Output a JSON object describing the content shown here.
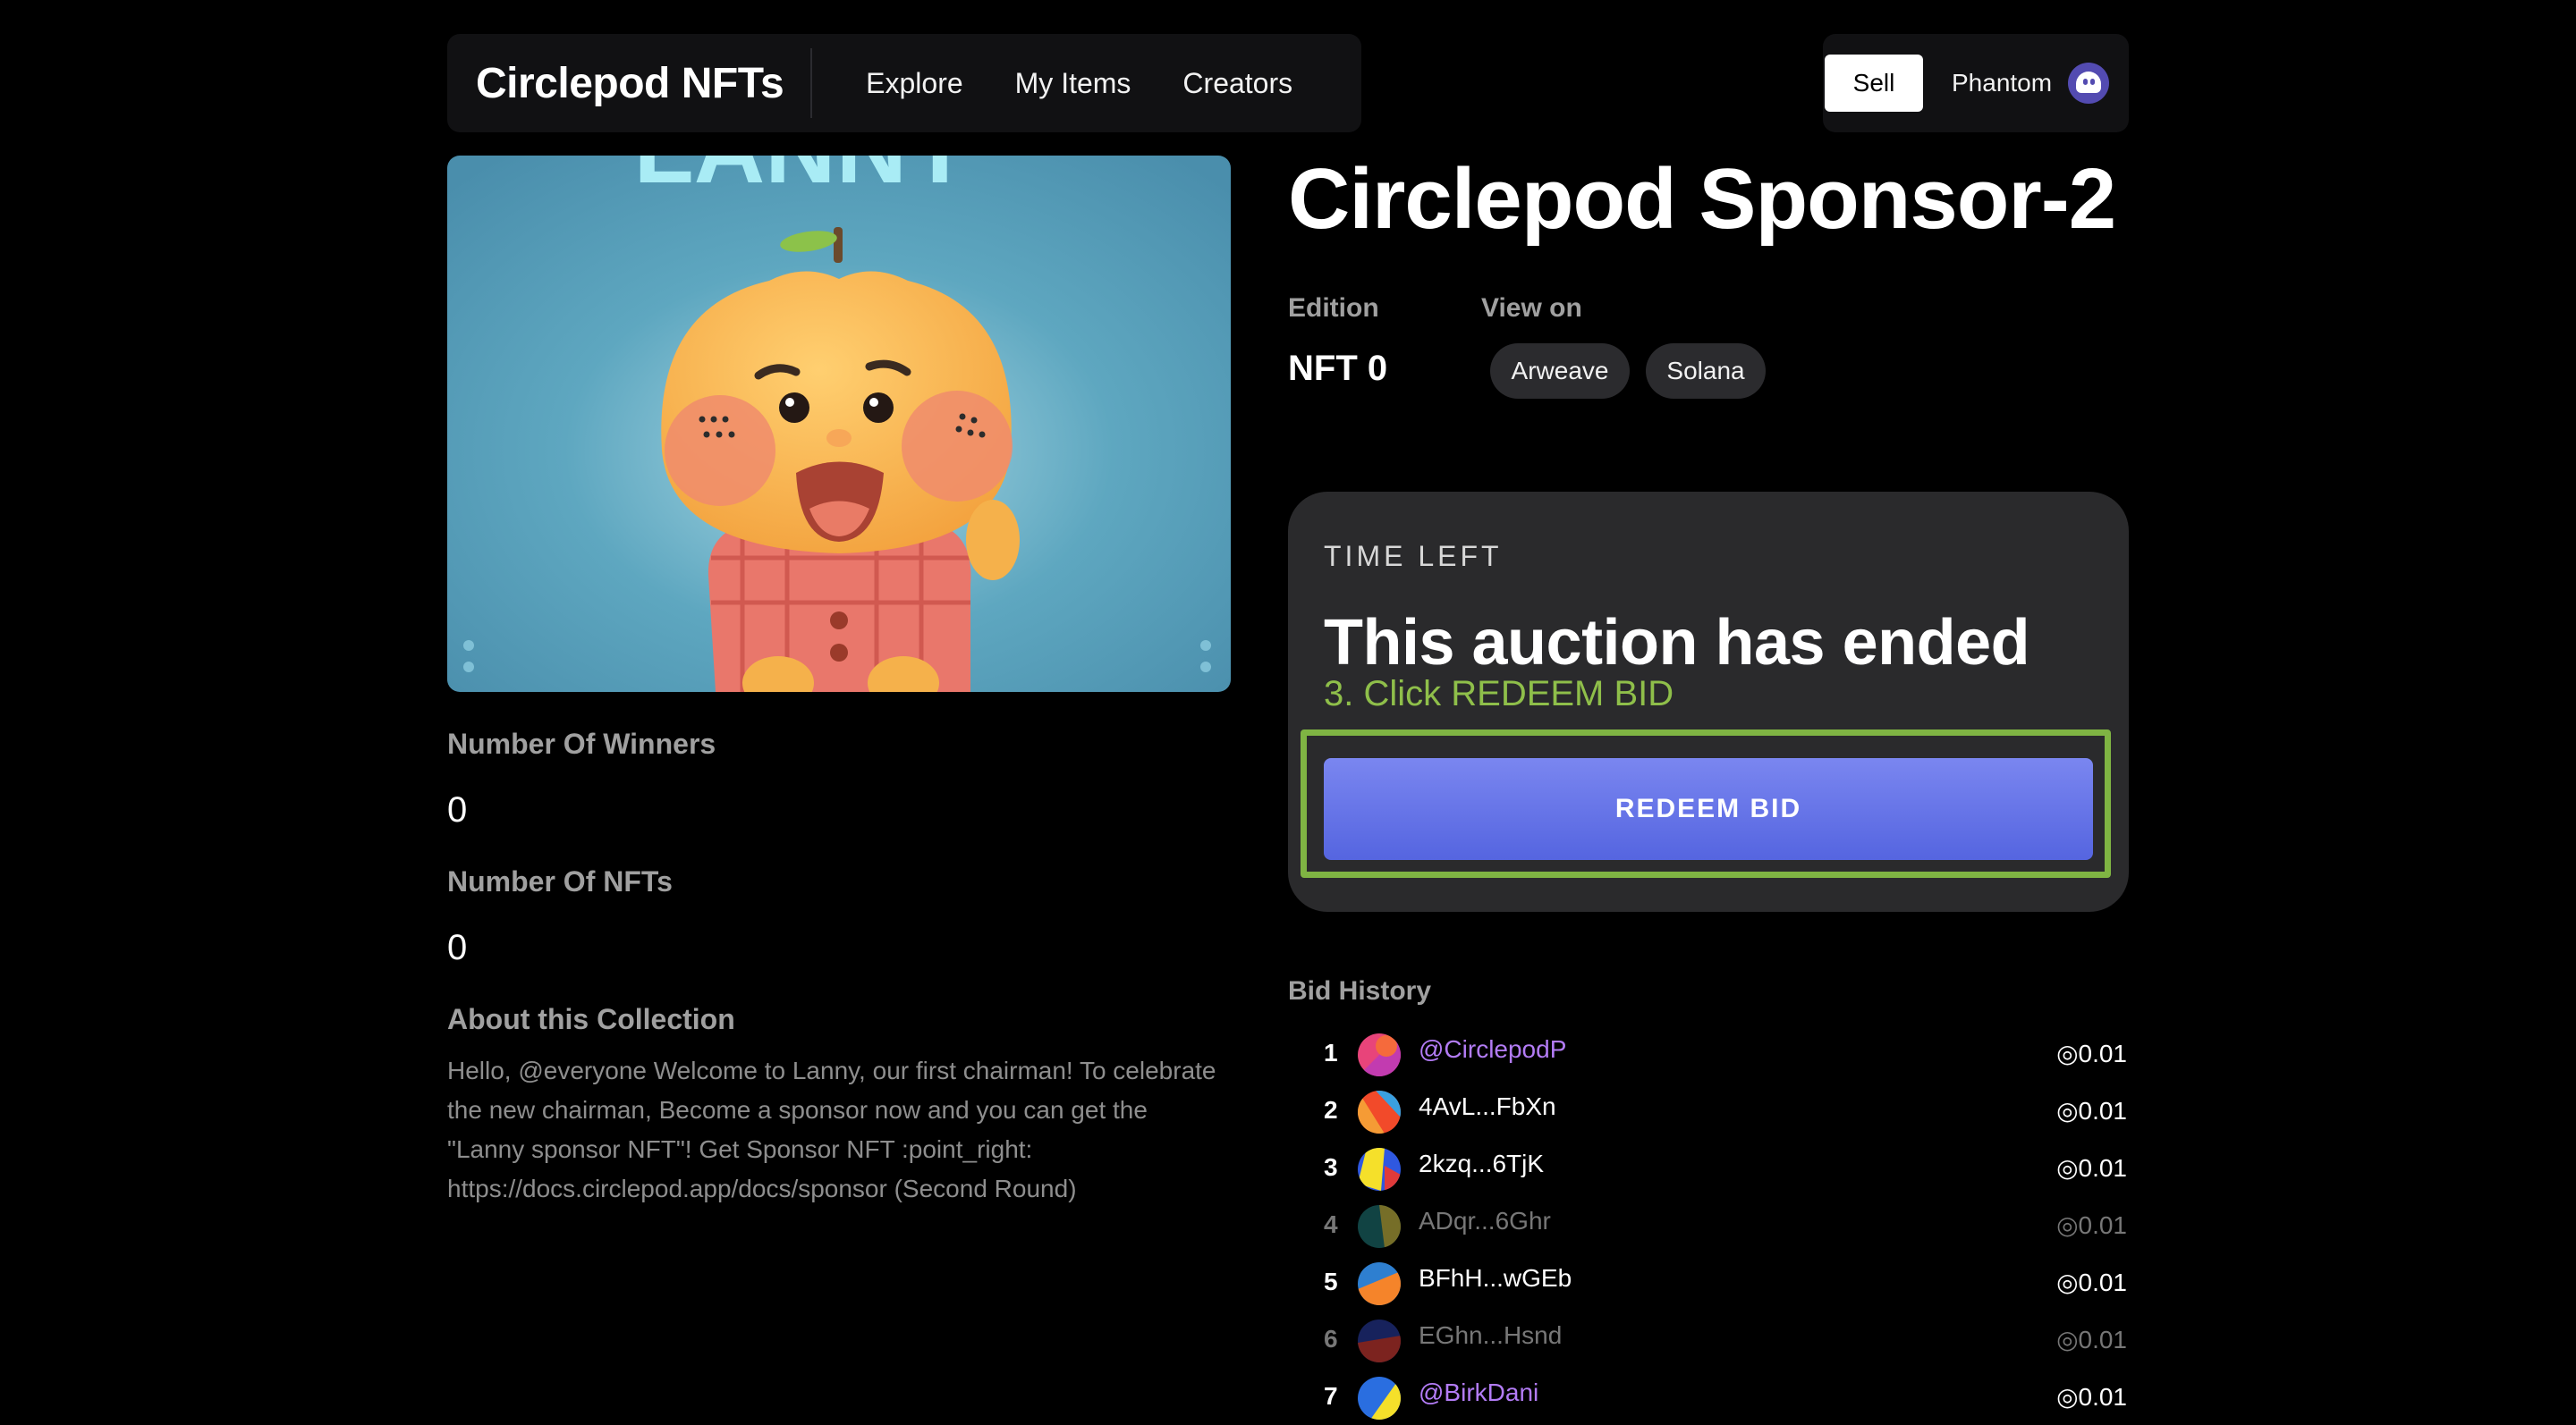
{
  "header": {
    "brand": "Circlepod NFTs",
    "nav": [
      "Explore",
      "My Items",
      "Creators"
    ],
    "sell_label": "Sell",
    "wallet_name": "Phantom"
  },
  "artwork": {
    "caption_partial": "LANNY",
    "background_color": "#4f95b2"
  },
  "left": {
    "winners_label": "Number Of Winners",
    "winners_value": "0",
    "nfts_label": "Number Of NFTs",
    "nfts_value": "0",
    "about_label": "About this Collection",
    "about_text": "Hello, @everyone Welcome to Lanny, our first chairman! To celebrate the new chairman, Become a sponsor now and you can get the \"Lanny sponsor NFT\"! Get Sponsor NFT :point_right: https://docs.circlepod.app/docs/sponsor (Second Round)"
  },
  "item": {
    "title": "Circlepod Sponsor-2",
    "edition_label": "Edition",
    "edition_value": "NFT 0",
    "view_on_label": "View on",
    "view_on": [
      "Arweave",
      "Solana"
    ]
  },
  "auction": {
    "time_left_label": "TIME LEFT",
    "status": "This auction has ended",
    "hint": "3. Click REDEEM BID",
    "redeem_label": "REDEEM BID",
    "accent_color": "#5b6be6",
    "highlight_color": "#7fb443"
  },
  "bids": {
    "label": "Bid History",
    "rows": [
      {
        "rank": "1",
        "name": "@CirclepodP",
        "amount": "◎0.01",
        "style": "purple"
      },
      {
        "rank": "2",
        "name": "4AvL...FbXn",
        "amount": "◎0.01",
        "style": "normal"
      },
      {
        "rank": "3",
        "name": "2kzq...6TjK",
        "amount": "◎0.01",
        "style": "normal"
      },
      {
        "rank": "4",
        "name": "ADqr...6Ghr",
        "amount": "◎0.01",
        "style": "dim"
      },
      {
        "rank": "5",
        "name": "BFhH...wGEb",
        "amount": "◎0.01",
        "style": "normal"
      },
      {
        "rank": "6",
        "name": "EGhn...Hsnd",
        "amount": "◎0.01",
        "style": "dim"
      },
      {
        "rank": "7",
        "name": "@BirkDani",
        "amount": "◎0.01",
        "style": "purple"
      }
    ]
  }
}
